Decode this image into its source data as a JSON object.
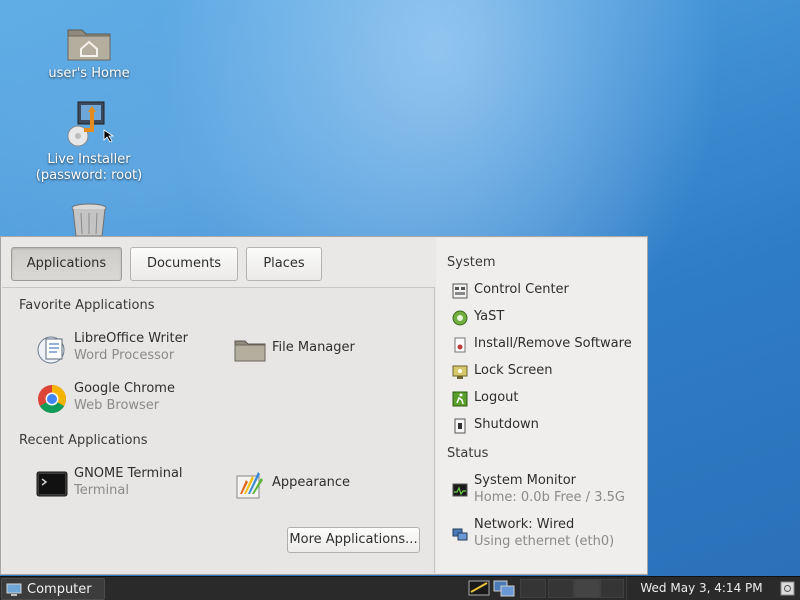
{
  "desktop": {
    "icons": [
      {
        "label": "user's Home",
        "icon": "home-folder-icon"
      },
      {
        "label_line1": "Live Installer",
        "label_line2": "(password: root)",
        "icon": "installer-icon"
      },
      {
        "label": "",
        "icon": "trash-icon"
      }
    ]
  },
  "menu": {
    "tabs": [
      {
        "label": "Applications",
        "active": true
      },
      {
        "label": "Documents",
        "active": false
      },
      {
        "label": "Places",
        "active": false
      }
    ],
    "favorites_title": "Favorite Applications",
    "favorites": [
      {
        "name": "LibreOffice Writer",
        "desc": "Word Processor",
        "icon": "libreoffice-writer-icon"
      },
      {
        "name": "File Manager",
        "desc": "",
        "icon": "file-manager-icon"
      },
      {
        "name": "Google Chrome",
        "desc": "Web Browser",
        "icon": "chrome-icon"
      }
    ],
    "recent_title": "Recent Applications",
    "recent": [
      {
        "name": "GNOME Terminal",
        "desc": "Terminal",
        "icon": "terminal-icon"
      },
      {
        "name": "Appearance",
        "desc": "",
        "icon": "appearance-icon"
      }
    ],
    "more_button": "More Applications...",
    "system_title": "System",
    "system_items": [
      {
        "label": "Control Center",
        "icon": "control-center-icon"
      },
      {
        "label": "YaST",
        "icon": "yast-icon"
      },
      {
        "label": "Install/Remove Software",
        "icon": "software-icon"
      },
      {
        "label": "Lock Screen",
        "icon": "lock-screen-icon"
      },
      {
        "label": "Logout",
        "icon": "logout-icon"
      },
      {
        "label": "Shutdown",
        "icon": "shutdown-icon"
      }
    ],
    "status_title": "Status",
    "status_items": [
      {
        "label": "System Monitor",
        "sub": "Home: 0.0b Free / 3.5G",
        "icon": "system-monitor-icon"
      },
      {
        "label": "Network: Wired",
        "sub": "Using ethernet (eth0)",
        "icon": "network-icon"
      }
    ]
  },
  "taskbar": {
    "start_label": "Computer",
    "clock": "Wed May  3,  4:14 PM"
  },
  "colors": {
    "wallpaper": "#3f8fd4",
    "menu_bg": "#e7e6e4",
    "taskbar_bg": "#2a2a2a"
  }
}
